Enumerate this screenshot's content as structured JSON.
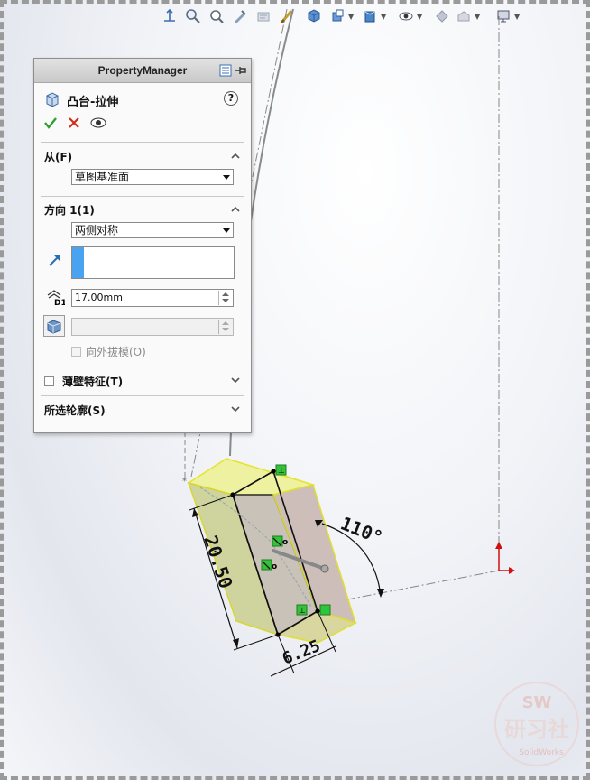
{
  "pm": {
    "title": "PropertyManager",
    "feature_title": "凸台-拉伸",
    "help_label": "?",
    "from": {
      "label": "从(F)",
      "value": "草图基准面"
    },
    "direction1": {
      "label": "方向 1(1)",
      "end_condition": "两侧对称",
      "depth": "17.00mm",
      "draft_value": "",
      "draft_outward_label": "向外拔模(O)"
    },
    "thin_feature": {
      "label": "薄壁特征(T)"
    },
    "selected_contours": {
      "label": "所选轮廓(S)"
    }
  },
  "model": {
    "dims": {
      "angle": "110°",
      "length": "20.50",
      "width": "6.25"
    },
    "relation_marks": {
      "perpendicular": "⊥",
      "coincident": "o"
    }
  },
  "watermark": {
    "line1": "SW",
    "line2": "研习社",
    "line3": "SolidWorks"
  },
  "colors": {
    "accept": "#2fa12f",
    "cancel": "#d12d1d",
    "selection_bar": "#4aa3f0",
    "face_yellow": "#e8ee96",
    "edge_yellow": "#ecec2a",
    "face_grey": "#c8bfba",
    "relation_green": "#35c23a"
  }
}
